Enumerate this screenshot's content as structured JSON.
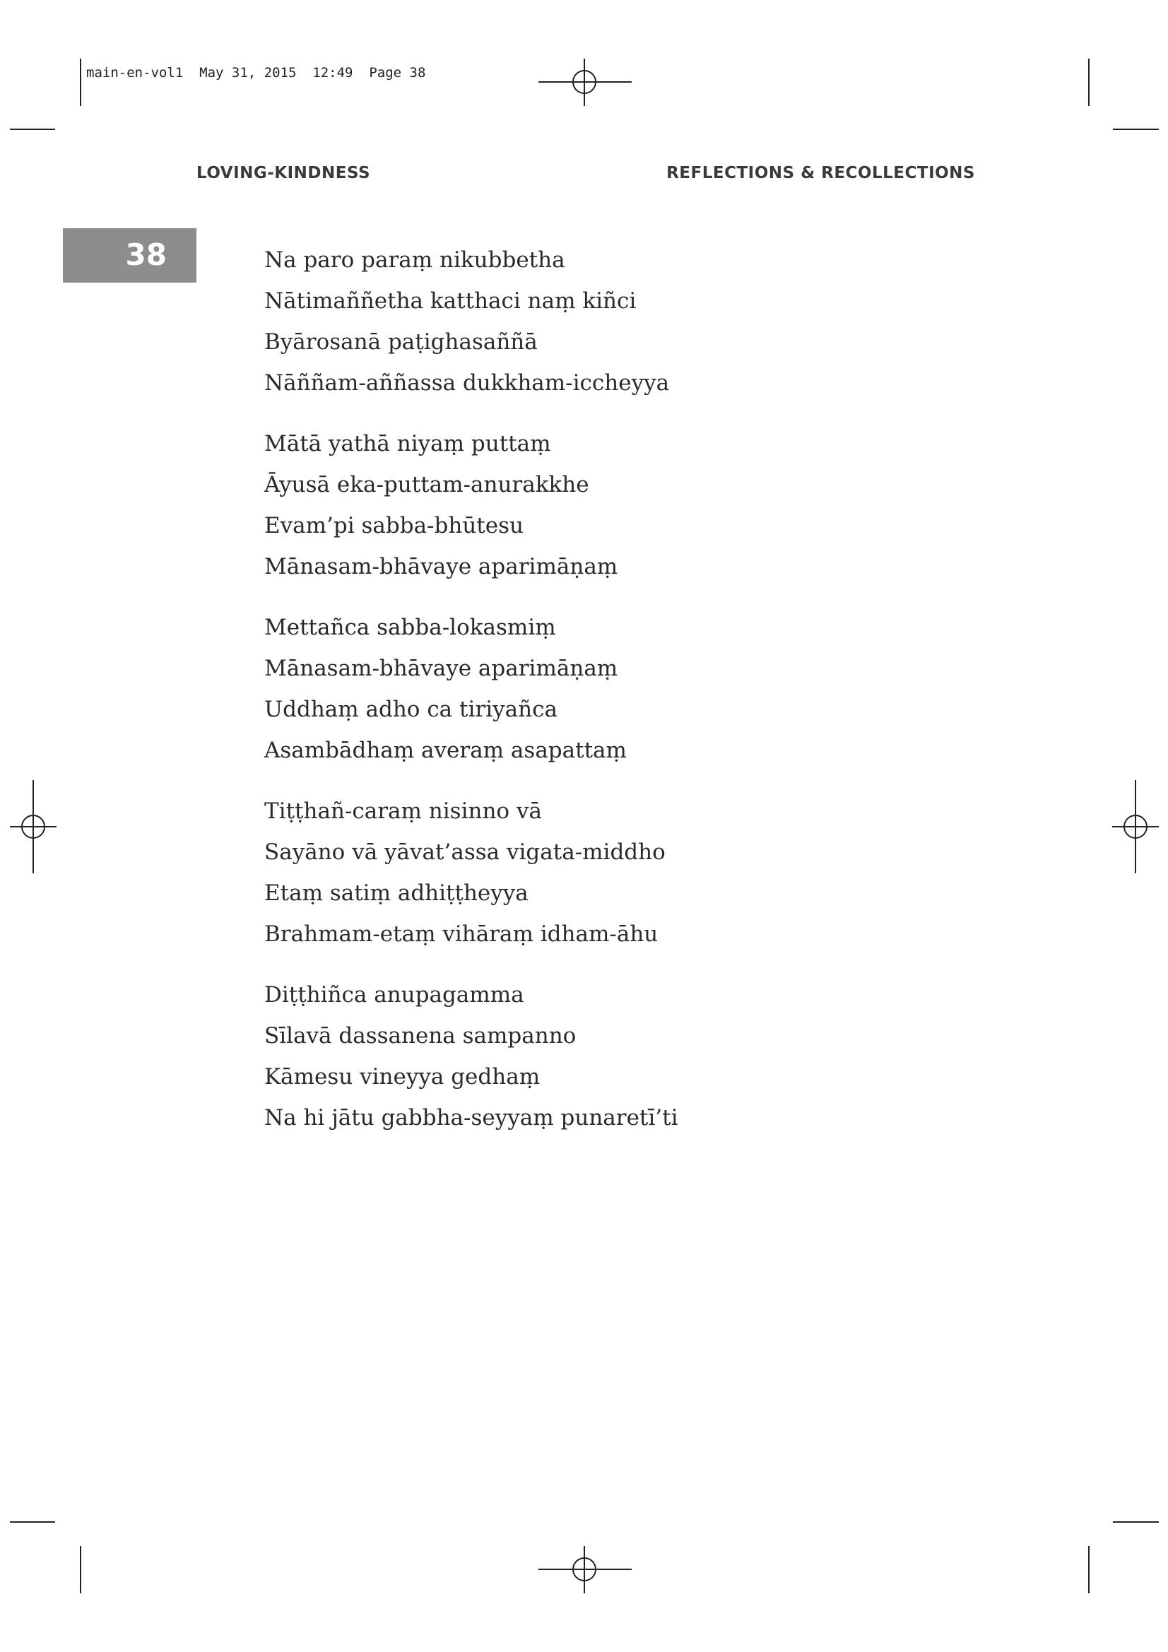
{
  "print_slug": "main-en-vol1  May 31, 2015  12:49  Page 38",
  "header": {
    "left": "LOVING-KINDNESS",
    "right": "REFLECTIONS & RECOLLECTIONS"
  },
  "page_number": "38",
  "stanzas": [
    [
      "Na paro paraṃ nikubbetha",
      "Nātimaññetha katthaci naṃ kiñci",
      "Byārosanā paṭighasaññā",
      "Nāññam-aññassa dukkham-iccheyya"
    ],
    [
      "Mātā yathā niyaṃ puttaṃ",
      "Āyusā eka-puttam-anurakkhe",
      "Evam’pi sabba-bhūtesu",
      "Mānasam-bhāvaye aparimāṇaṃ"
    ],
    [
      "Mettañca sabba-lokasmiṃ",
      "Mānasam-bhāvaye aparimāṇaṃ",
      "Uddhaṃ adho ca tiriyañca",
      "Asambādhaṃ averaṃ asapattaṃ"
    ],
    [
      "Tiṭṭhañ-caraṃ nisinno vā",
      "Sayāno vā yāvat’assa vigata-middho",
      "Etaṃ satiṃ adhiṭṭheyya",
      "Brahmam-etaṃ vihāraṃ idham-āhu"
    ],
    [
      "Diṭṭhiñca anupagamma",
      "Sīlavā dassanena sampanno",
      "Kāmesu vineyya gedhaṃ",
      "Na hi jātu gabbha-seyyaṃ punaretī’ti"
    ]
  ]
}
